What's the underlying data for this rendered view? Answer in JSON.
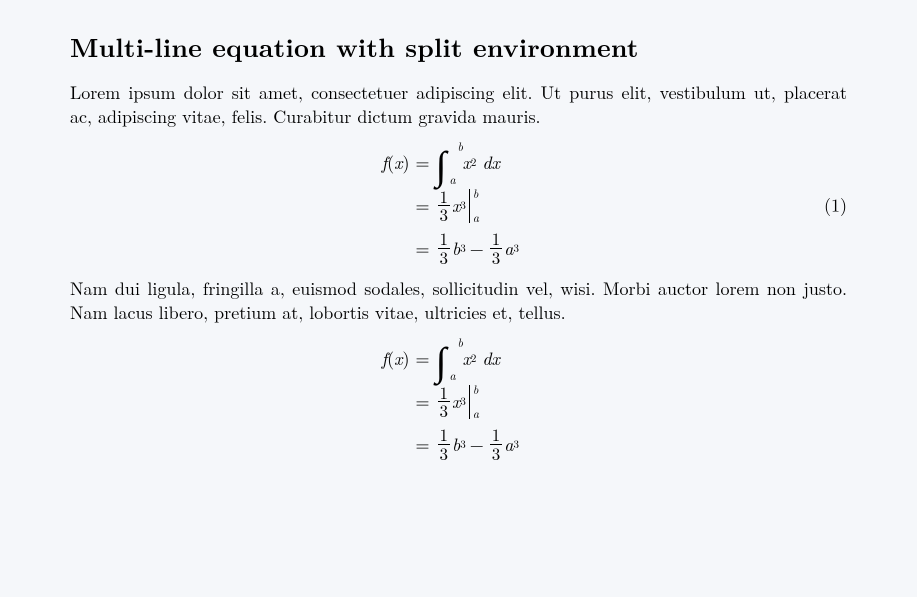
{
  "title": "Multi-line equation with split environment",
  "para1": "Lorem ipsum dolor sit amet, consectetuer adipiscing elit. Ut purus elit, vestibulum ut, placerat ac, adipiscing vitae, felis. Curabitur dictum gravida mauris.",
  "para2": "Nam dui ligula, fringilla a, euismod sodales, sollicitudin vel, wisi. Morbi auctor lorem non justo. Nam lacus libero, pretium at, lobortis vitae, ultricies et, tellus.",
  "eq": {
    "number": "(1)",
    "lhs_fn": "f",
    "lhs_lp": "(",
    "lhs_var": "x",
    "lhs_rp": ")",
    "equals": "=",
    "minus": "−",
    "int_lower": "a",
    "int_upper": "b",
    "integrand_base": "x",
    "integrand_pow": "2",
    "diff": "dx",
    "frac_num": "1",
    "frac_den": "3",
    "antid_base": "x",
    "antid_pow": "3",
    "eval_lower": "a",
    "eval_upper": "b",
    "term_b_base": "b",
    "term_b_pow": "3",
    "term_a_base": "a",
    "term_a_pow": "3"
  }
}
